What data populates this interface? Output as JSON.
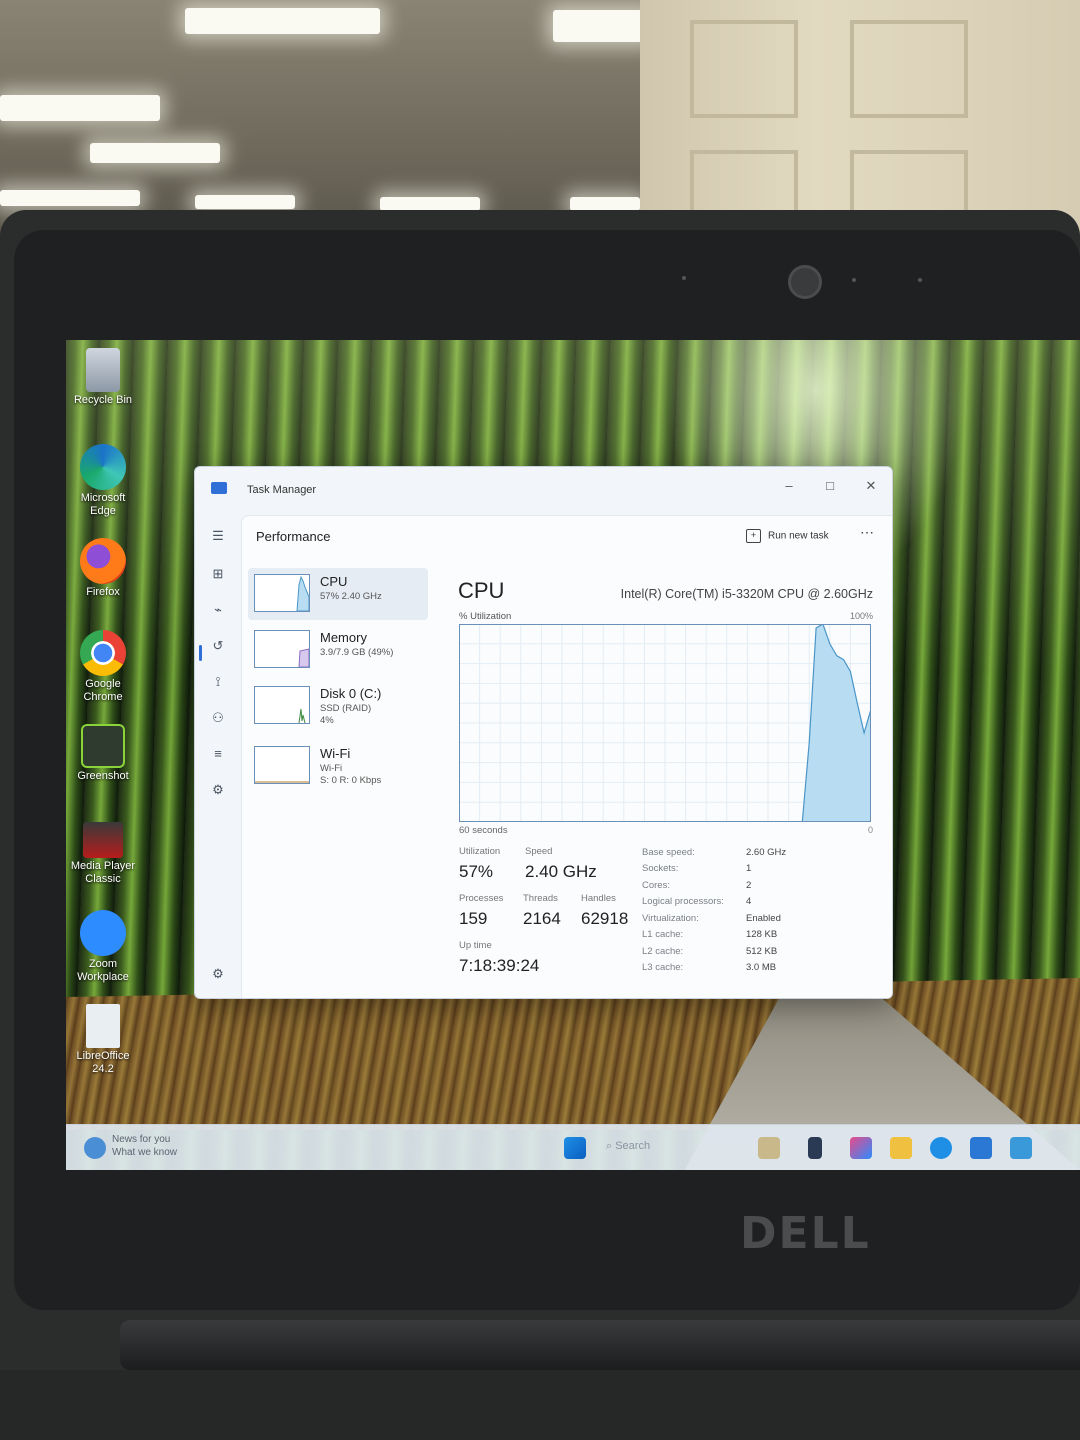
{
  "brand_logo": "DELL",
  "desktop_icons": [
    {
      "label": "Recycle Bin",
      "icon": "recycle-bin-icon"
    },
    {
      "label": "Microsoft Edge",
      "icon": "edge-icon"
    },
    {
      "label": "Firefox",
      "icon": "firefox-icon"
    },
    {
      "label": "Google Chrome",
      "icon": "chrome-icon"
    },
    {
      "label": "Greenshot",
      "icon": "greenshot-icon"
    },
    {
      "label": "Media Player Classic",
      "icon": "media-player-icon"
    },
    {
      "label": "Zoom Workplace",
      "icon": "zoom-icon"
    },
    {
      "label": "LibreOffice 24.2",
      "icon": "libreoffice-icon"
    }
  ],
  "taskbar": {
    "news_title": "News for you",
    "news_sub": "What we know",
    "search_placeholder": "Search"
  },
  "task_manager": {
    "title": "Task Manager",
    "section": "Performance",
    "run_new_task": "Run new task",
    "devices": [
      {
        "name": "CPU",
        "sub1": "57% 2.40 GHz",
        "sub2": ""
      },
      {
        "name": "Memory",
        "sub1": "3.9/7.9 GB (49%)",
        "sub2": ""
      },
      {
        "name": "Disk 0 (C:)",
        "sub1": "SSD (RAID)",
        "sub2": "4%"
      },
      {
        "name": "Wi-Fi",
        "sub1": "Wi-Fi",
        "sub2": "S: 0 R: 0 Kbps"
      }
    ],
    "cpu": {
      "title": "CPU",
      "model": "Intel(R) Core(TM) i5-3320M CPU @ 2.60GHz",
      "utilization_label": "% Utilization",
      "max_label": "100%",
      "time_label": "60 seconds",
      "min_label": "0",
      "stats": {
        "utilization": {
          "label": "Utilization",
          "value": "57%"
        },
        "speed": {
          "label": "Speed",
          "value": "2.40 GHz"
        },
        "processes": {
          "label": "Processes",
          "value": "159"
        },
        "threads": {
          "label": "Threads",
          "value": "2164"
        },
        "handles": {
          "label": "Handles",
          "value": "62918"
        },
        "uptime": {
          "label": "Up time",
          "value": "7:18:39:24"
        }
      },
      "specs": [
        {
          "key": "Base speed:",
          "value": "2.60 GHz"
        },
        {
          "key": "Sockets:",
          "value": "1"
        },
        {
          "key": "Cores:",
          "value": "2"
        },
        {
          "key": "Logical processors:",
          "value": "4"
        },
        {
          "key": "Virtualization:",
          "value": "Enabled"
        },
        {
          "key": "L1 cache:",
          "value": "128 KB"
        },
        {
          "key": "L2 cache:",
          "value": "512 KB"
        },
        {
          "key": "L3 cache:",
          "value": "3.0 MB"
        }
      ]
    }
  },
  "chart_data": {
    "type": "area",
    "title": "CPU",
    "xlabel": "60 seconds",
    "ylabel": "% Utilization",
    "ylim": [
      0,
      100
    ],
    "grid": true,
    "x": [
      0,
      45,
      50,
      51,
      52,
      53,
      54,
      55,
      56,
      57,
      58,
      59,
      60
    ],
    "y": [
      0,
      0,
      0,
      40,
      98,
      100,
      90,
      84,
      82,
      76,
      60,
      45,
      57
    ]
  },
  "colors": {
    "accent": "#2f6fd6",
    "graph_line": "#4a96c8",
    "graph_fill": "#b8dcf2"
  }
}
